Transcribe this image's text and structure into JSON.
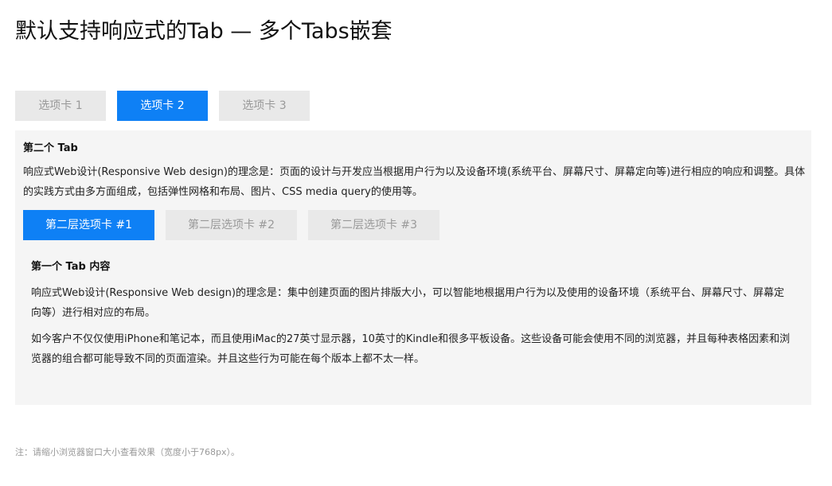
{
  "page": {
    "title": "默认支持响应式的Tab — 多个Tabs嵌套"
  },
  "outer_tabs": [
    {
      "label": "选项卡 1",
      "active": false
    },
    {
      "label": "选项卡 2",
      "active": true
    },
    {
      "label": "选项卡 3",
      "active": false
    }
  ],
  "panel": {
    "heading": "第二个 Tab",
    "text": "响应式Web设计(Responsive Web design)的理念是：页面的设计与开发应当根据用户行为以及设备环境(系统平台、屏幕尺寸、屏幕定向等)进行相应的响应和调整。具体的实践方式由多方面组成，包括弹性网格和布局、图片、CSS media query的使用等。"
  },
  "inner_tabs": [
    {
      "label": "第二层选项卡 #1",
      "active": true
    },
    {
      "label": "第二层选项卡 #2",
      "active": false
    },
    {
      "label": "第二层选项卡 #3",
      "active": false
    }
  ],
  "inner_content": {
    "heading": "第一个 Tab 内容",
    "para1": "响应式Web设计(Responsive Web design)的理念是：集中创建页面的图片排版大小，可以智能地根据用户行为以及使用的设备环境（系统平台、屏幕尺寸、屏幕定向等）进行相对应的布局。",
    "para2": "如今客户不仅仅使用iPhone和笔记本，而且使用iMac的27英寸显示器，10英寸的Kindle和很多平板设备。这些设备可能会使用不同的浏览器，并且每种表格因素和浏览器的组合都可能导致不同的页面渲染。并且这些行为可能在每个版本上都不太一样。"
  },
  "footnote": "注：请缩小浏览器窗口大小查看效果（宽度小于768px）。",
  "colors": {
    "accent": "#0e80f5",
    "tab_inactive_bg": "#e9e9e9",
    "tab_inactive_text": "#999999",
    "panel_bg": "#f5f5f5"
  }
}
